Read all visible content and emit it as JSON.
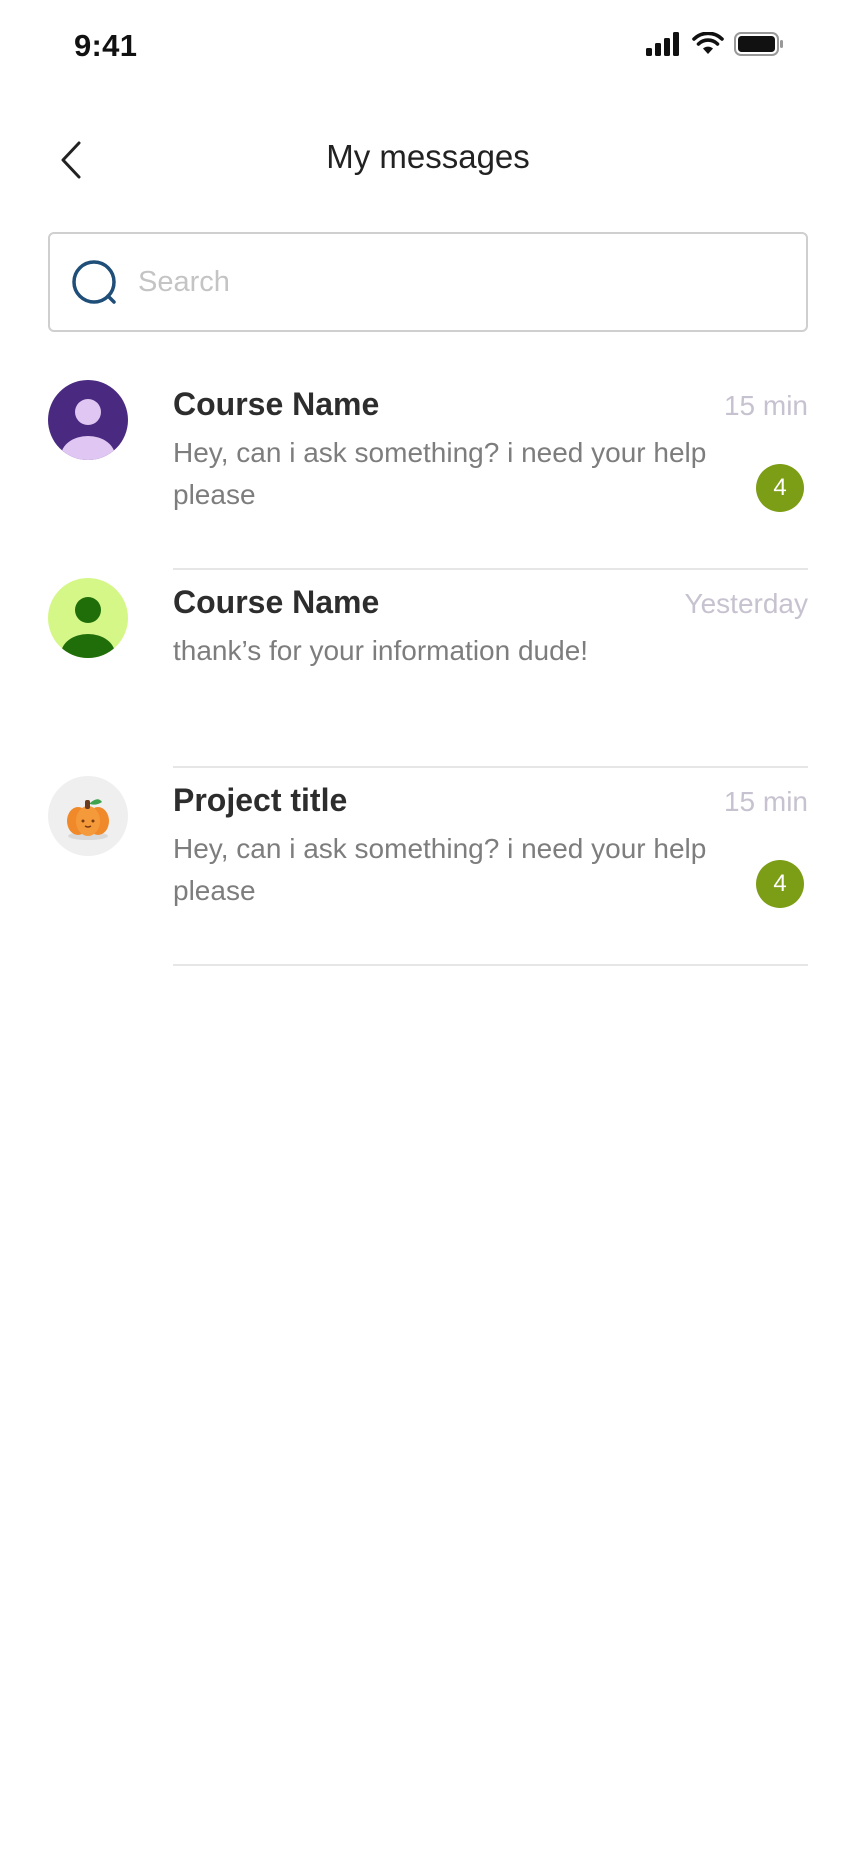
{
  "status_bar": {
    "time": "9:41"
  },
  "header": {
    "title": "My messages"
  },
  "search": {
    "placeholder": "Search",
    "value": ""
  },
  "colors": {
    "badge": "#7c9d16",
    "time_text": "#c7c2cf",
    "preview_text": "#7d7d7d"
  },
  "messages": [
    {
      "name": "Course Name",
      "time": "15 min",
      "preview": "Hey, can i ask something? i need your help please",
      "badge": "4",
      "avatar": "user-avatar-purple"
    },
    {
      "name": "Course Name",
      "time": "Yesterday",
      "preview": "thank’s for your information dude!",
      "badge": "",
      "avatar": "user-avatar-green"
    },
    {
      "name": "Project title",
      "time": "15 min",
      "preview": "Hey, can i ask something? i need your help please",
      "badge": "4",
      "avatar": "pumpkin-avatar"
    }
  ]
}
